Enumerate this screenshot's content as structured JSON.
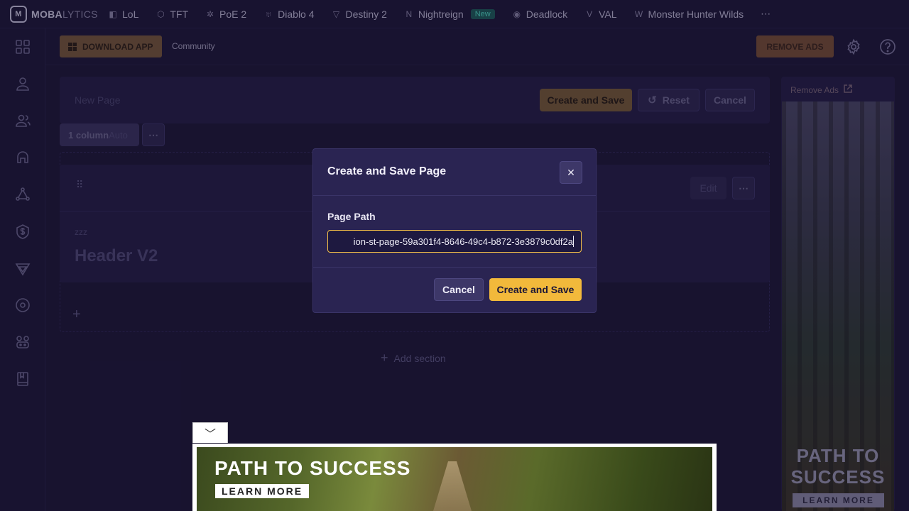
{
  "topnav": {
    "logo": {
      "bold": "MOBA",
      "light": "LYTICS"
    },
    "items": [
      {
        "label": "LoL",
        "icon": "lol-icon"
      },
      {
        "label": "TFT",
        "icon": "tft-icon"
      },
      {
        "label": "PoE 2",
        "icon": "poe-icon"
      },
      {
        "label": "Diablo 4",
        "icon": "diablo-icon"
      },
      {
        "label": "Destiny 2",
        "icon": "destiny-icon"
      },
      {
        "label": "Nightreign",
        "icon": "nightreign-icon",
        "badge": "New"
      },
      {
        "label": "Deadlock",
        "icon": "deadlock-icon"
      },
      {
        "label": "VAL",
        "icon": "valorant-icon"
      },
      {
        "label": "Monster Hunter Wilds",
        "icon": "mhw-icon"
      }
    ],
    "more": "⋯"
  },
  "subbar": {
    "download_label": "DOWNLOAD APP",
    "community_label": "Community",
    "remove_ads_label": "REMOVE ADS"
  },
  "editor": {
    "page_name_placeholder": "New Page",
    "create_save_label": "Create and Save",
    "reset_label": "Reset",
    "cancel_label": "Cancel",
    "columns_label": "1 column",
    "columns_mode": "Auto",
    "more": "⋯",
    "widget": {
      "edit_label": "Edit",
      "subtitle": "zzz",
      "title": "Header V2"
    },
    "add_symbol": "+",
    "add_section_label": "Add section"
  },
  "modal": {
    "title": "Create and Save Page",
    "field_label": "Page Path",
    "path_value": "ion-st-page-59a301f4-8646-49c4-b872-3e3879c0df2a",
    "cancel_label": "Cancel",
    "save_label": "Create and Save"
  },
  "side_ad": {
    "header": "Remove Ads",
    "title": "PATH TO SUCCESS",
    "cta": "LEARN MORE"
  },
  "banner_ad": {
    "title": "PATH TO SUCCESS",
    "cta": "LEARN MORE",
    "toggle": "﹀"
  },
  "colors": {
    "accent": "#f2b93b",
    "bg": "#1b1636",
    "modal_bg": "#2a2452"
  }
}
